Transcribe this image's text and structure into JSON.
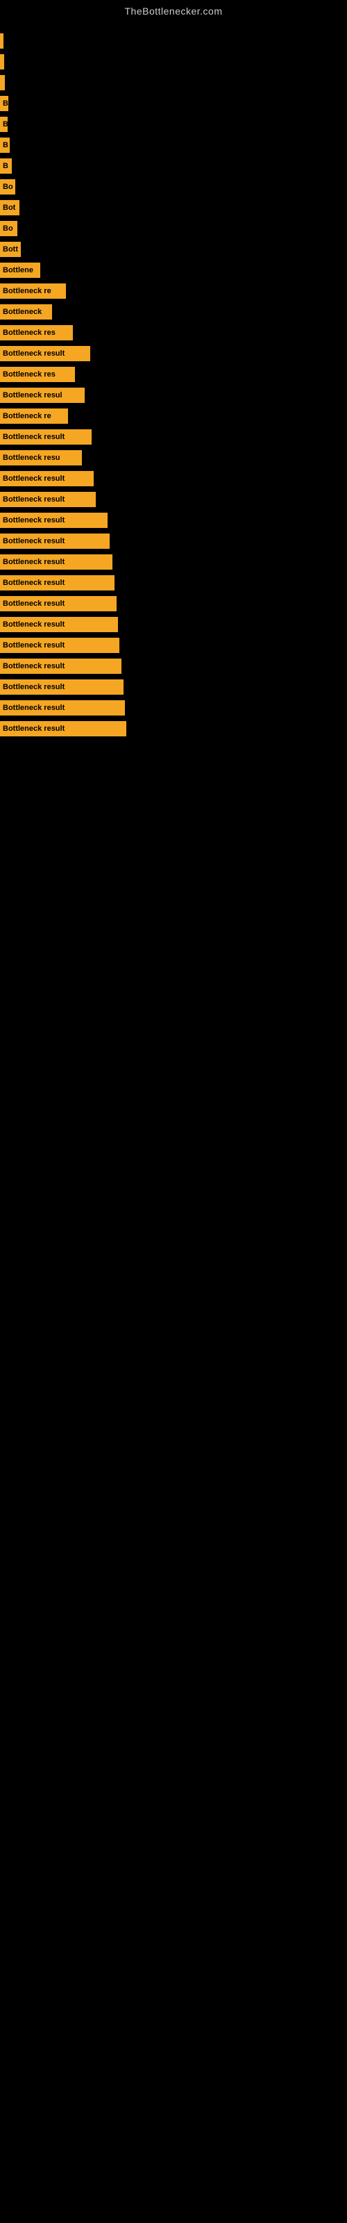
{
  "header": {
    "title": "TheBottlenecker.com"
  },
  "bars": [
    {
      "label": "",
      "width": 5
    },
    {
      "label": "",
      "width": 6
    },
    {
      "label": "",
      "width": 7
    },
    {
      "label": "B",
      "width": 12
    },
    {
      "label": "B",
      "width": 11
    },
    {
      "label": "B",
      "width": 14
    },
    {
      "label": "B",
      "width": 17
    },
    {
      "label": "Bo",
      "width": 22
    },
    {
      "label": "Bot",
      "width": 28
    },
    {
      "label": "Bo",
      "width": 25
    },
    {
      "label": "Bott",
      "width": 30
    },
    {
      "label": "Bottlene",
      "width": 58
    },
    {
      "label": "Bottleneck re",
      "width": 95
    },
    {
      "label": "Bottleneck",
      "width": 75
    },
    {
      "label": "Bottleneck res",
      "width": 105
    },
    {
      "label": "Bottleneck result",
      "width": 130
    },
    {
      "label": "Bottleneck res",
      "width": 108
    },
    {
      "label": "Bottleneck resul",
      "width": 122
    },
    {
      "label": "Bottleneck re",
      "width": 98
    },
    {
      "label": "Bottleneck result",
      "width": 132
    },
    {
      "label": "Bottleneck resu",
      "width": 118
    },
    {
      "label": "Bottleneck result",
      "width": 135
    },
    {
      "label": "Bottleneck result",
      "width": 138
    },
    {
      "label": "Bottleneck result",
      "width": 155
    },
    {
      "label": "Bottleneck result",
      "width": 158
    },
    {
      "label": "Bottleneck result",
      "width": 162
    },
    {
      "label": "Bottleneck result",
      "width": 165
    },
    {
      "label": "Bottleneck result",
      "width": 168
    },
    {
      "label": "Bottleneck result",
      "width": 170
    },
    {
      "label": "Bottleneck result",
      "width": 172
    },
    {
      "label": "Bottleneck result",
      "width": 175
    },
    {
      "label": "Bottleneck result",
      "width": 178
    },
    {
      "label": "Bottleneck result",
      "width": 180
    },
    {
      "label": "Bottleneck result",
      "width": 182
    }
  ]
}
